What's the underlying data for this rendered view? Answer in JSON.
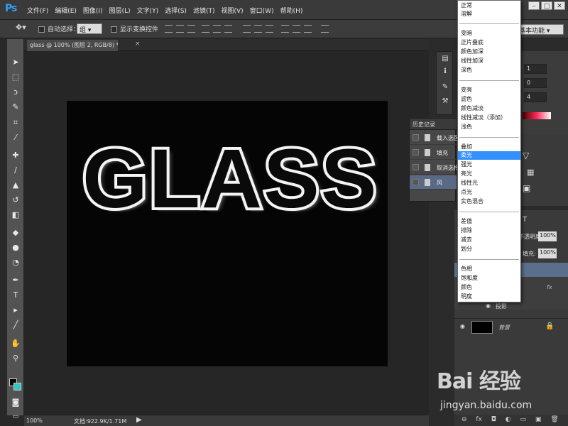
{
  "app": {
    "logo": "Ps"
  },
  "menu": [
    "文件(F)",
    "编辑(E)",
    "图像(I)",
    "图层(L)",
    "文字(Y)",
    "选择(S)",
    "滤镜(T)",
    "视图(V)",
    "窗口(W)",
    "帮助(H)"
  ],
  "window_controls": [
    "–",
    "□",
    "✕"
  ],
  "options": {
    "auto_select_label": "自动选择：",
    "auto_select_value": "组",
    "show_transform_label": "显示变换控件",
    "workspace": "基本功能"
  },
  "document": {
    "tab_title": "glass @ 100% (图层 2, RGB/8) *",
    "tab_close": "×",
    "canvas_text": "GLASS"
  },
  "status": {
    "zoom": "100%",
    "doc_info": "文档:922.9K/1.71M",
    "arrow": "▶"
  },
  "history": {
    "title": "历史记录",
    "items": [
      "载入选区",
      "填充",
      "取消选择",
      "风"
    ]
  },
  "properties": {
    "values": [
      "1",
      "0",
      "4"
    ]
  },
  "layers": {
    "opacity_label": "不透明度:",
    "opacity_value": "100%",
    "fill_label": "填充:",
    "fill_value": "100%",
    "effects_label": "效果",
    "shadow_label": "投影",
    "fx_label": "fx",
    "background_label": "背景",
    "bottom_icons": [
      "⊖",
      "fx",
      "◘",
      "◐",
      "▭",
      "▣",
      "🗑"
    ]
  },
  "blend_modes": {
    "groups": [
      [
        "正常",
        "溶解"
      ],
      [
        "变暗",
        "正片叠底",
        "颜色加深",
        "线性加深",
        "深色"
      ],
      [
        "变亮",
        "滤色",
        "颜色减淡",
        "线性减淡（添加）",
        "浅色"
      ],
      [
        "叠加",
        "柔光",
        "强光",
        "亮光",
        "线性光",
        "点光",
        "实色混合"
      ],
      [
        "差值",
        "排除",
        "减去",
        "划分"
      ],
      [
        "色相",
        "饱和度",
        "颜色",
        "明度"
      ]
    ],
    "selected": "柔光"
  },
  "watermark": {
    "logo": "Bai 经验",
    "url": "jingyan.baidu.com"
  },
  "colors": {
    "accent": "#3390ff",
    "foreground": "#000000",
    "background": "#35c4c4"
  },
  "icons": {
    "tools": [
      "move-tool-icon",
      "marquee-tool-icon",
      "lasso-tool-icon",
      "quick-select-icon",
      "crop-icon",
      "eyedropper-icon",
      "healing-brush-icon",
      "brush-icon",
      "stamp-icon",
      "history-brush-icon",
      "eraser-icon",
      "paint-bucket-icon",
      "blur-icon",
      "dodge-icon",
      "pen-icon",
      "type-icon",
      "path-select-icon",
      "line-icon",
      "hand-icon",
      "zoom-icon"
    ]
  }
}
